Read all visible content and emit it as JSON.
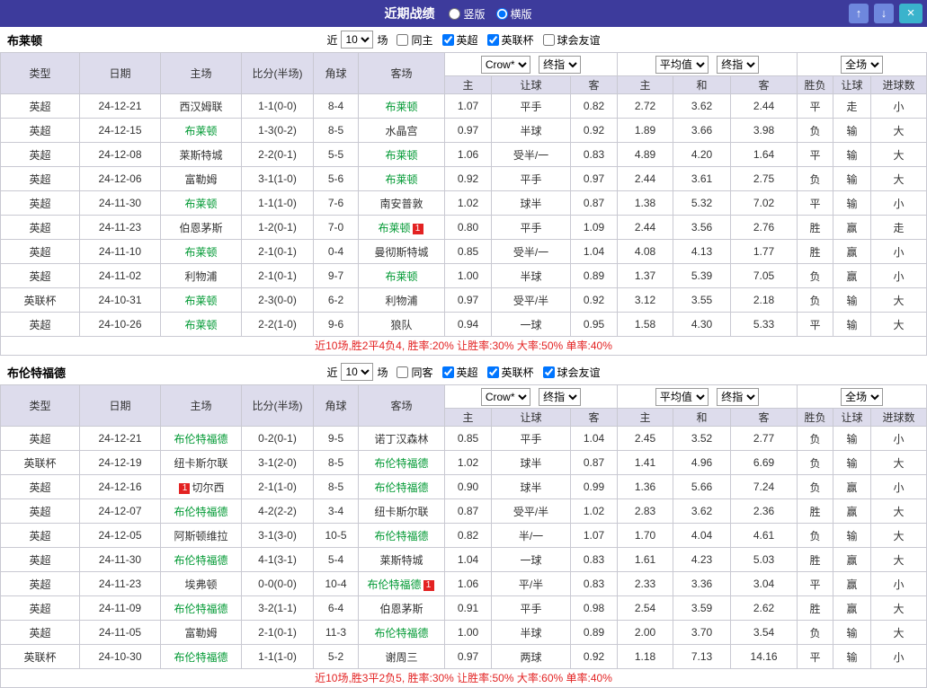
{
  "colors": {
    "titlebar_bg": "#3d3b9c",
    "btn_blue": "#6e87dd",
    "btn_teal": "#3ab3cc",
    "header_bg": "#dddcec",
    "league_bg": "#e83434",
    "league_cup_bg": "#d42f2f",
    "red": "#e32222",
    "green": "#009933",
    "blue": "#1f1fd0"
  },
  "titlebar": {
    "title": "近期战绩",
    "radios": [
      {
        "label": "竖版",
        "selected": false
      },
      {
        "label": "横版",
        "selected": true
      }
    ],
    "buttons": {
      "up": "↑",
      "down": "↓",
      "close": "×"
    }
  },
  "table_columns": {
    "main": [
      "类型",
      "日期",
      "主场",
      "比分(半场)",
      "角球",
      "客场"
    ],
    "sub": [
      "主",
      "让球",
      "客",
      "主",
      "和",
      "客",
      "胜负",
      "让球",
      "进球数"
    ]
  },
  "sections": [
    {
      "team": "布莱顿",
      "filter": {
        "near_label": "近",
        "count": "10",
        "unit_label": "场",
        "same": {
          "label": "同主",
          "checked": false
        },
        "leagues": [
          {
            "label": "英超",
            "checked": true
          },
          {
            "label": "英联杯",
            "checked": true
          },
          {
            "label": "球会友谊",
            "checked": false
          }
        ]
      },
      "dropdowns": {
        "odds_source": "Crow*",
        "odds_stage": "终指",
        "avg_type": "平均值",
        "avg_stage": "终指",
        "scope": "全场"
      },
      "rows": [
        {
          "type": "英超",
          "date": "24-12-21",
          "home": {
            "name": "西汉姆联"
          },
          "score": "1-1(0-0)",
          "corners": "8-4",
          "away": {
            "name": "布莱顿",
            "focus": true
          },
          "odds": [
            "1.07",
            "平手",
            "0.82"
          ],
          "avg": [
            "2.72",
            "3.62",
            "2.44"
          ],
          "result": "平",
          "hres": "走",
          "goals": "小"
        },
        {
          "type": "英超",
          "date": "24-12-15",
          "home": {
            "name": "布莱顿",
            "focus": true
          },
          "score": "1-3(0-2)",
          "corners": "8-5",
          "away": {
            "name": "水晶宫"
          },
          "odds": [
            "0.97",
            "半球",
            "0.92"
          ],
          "avg": [
            "1.89",
            "3.66",
            "3.98"
          ],
          "result": "负",
          "hres": "输",
          "goals": "大"
        },
        {
          "type": "英超",
          "date": "24-12-08",
          "home": {
            "name": "莱斯特城"
          },
          "score": "2-2(0-1)",
          "corners": "5-5",
          "away": {
            "name": "布莱顿",
            "focus": true
          },
          "odds": [
            "1.06",
            "受半/一",
            "0.83"
          ],
          "avg": [
            "4.89",
            "4.20",
            "1.64"
          ],
          "result": "平",
          "hres": "输",
          "goals": "大"
        },
        {
          "type": "英超",
          "date": "24-12-06",
          "home": {
            "name": "富勒姆"
          },
          "score": "3-1(1-0)",
          "corners": "5-6",
          "away": {
            "name": "布莱顿",
            "focus": true
          },
          "odds": [
            "0.92",
            "平手",
            "0.97"
          ],
          "avg": [
            "2.44",
            "3.61",
            "2.75"
          ],
          "result": "负",
          "hres": "输",
          "goals": "大"
        },
        {
          "type": "英超",
          "date": "24-11-30",
          "home": {
            "name": "布莱顿",
            "focus": true
          },
          "score": "1-1(1-0)",
          "corners": "7-6",
          "away": {
            "name": "南安普敦"
          },
          "odds": [
            "1.02",
            "球半",
            "0.87"
          ],
          "avg": [
            "1.38",
            "5.32",
            "7.02"
          ],
          "result": "平",
          "hres": "输",
          "goals": "小"
        },
        {
          "type": "英超",
          "date": "24-11-23",
          "home": {
            "name": "伯恩茅斯"
          },
          "score": "1-2(0-1)",
          "corners": "7-0",
          "away": {
            "name": "布莱顿",
            "focus": true,
            "card": "after"
          },
          "odds": [
            "0.80",
            "平手",
            "1.09"
          ],
          "avg": [
            "2.44",
            "3.56",
            "2.76"
          ],
          "result": "胜",
          "hres": "赢",
          "goals": "走"
        },
        {
          "type": "英超",
          "date": "24-11-10",
          "home": {
            "name": "布莱顿",
            "focus": true
          },
          "score": "2-1(0-1)",
          "corners": "0-4",
          "away": {
            "name": "曼彻斯特城"
          },
          "odds": [
            "0.85",
            "受半/一",
            "1.04"
          ],
          "avg": [
            "4.08",
            "4.13",
            "1.77"
          ],
          "result": "胜",
          "hres": "赢",
          "goals": "小"
        },
        {
          "type": "英超",
          "date": "24-11-02",
          "home": {
            "name": "利物浦"
          },
          "score": "2-1(0-1)",
          "corners": "9-7",
          "away": {
            "name": "布莱顿",
            "focus": true
          },
          "odds": [
            "1.00",
            "半球",
            "0.89"
          ],
          "avg": [
            "1.37",
            "5.39",
            "7.05"
          ],
          "result": "负",
          "hres": "赢",
          "goals": "小"
        },
        {
          "type": "英联杯",
          "date": "24-10-31",
          "home": {
            "name": "布莱顿",
            "focus": true
          },
          "score": "2-3(0-0)",
          "corners": "6-2",
          "away": {
            "name": "利物浦"
          },
          "odds": [
            "0.97",
            "受平/半",
            "0.92"
          ],
          "avg": [
            "3.12",
            "3.55",
            "2.18"
          ],
          "result": "负",
          "hres": "输",
          "goals": "大"
        },
        {
          "type": "英超",
          "date": "24-10-26",
          "home": {
            "name": "布莱顿",
            "focus": true
          },
          "score": "2-2(1-0)",
          "corners": "9-6",
          "away": {
            "name": "狼队"
          },
          "odds": [
            "0.94",
            "一球",
            "0.95"
          ],
          "avg": [
            "1.58",
            "4.30",
            "5.33"
          ],
          "result": "平",
          "hres": "输",
          "goals": "大"
        }
      ],
      "summary": "近10场,胜2平4负4, 胜率:20% 让胜率:30% 大率:50% 单率:40%"
    },
    {
      "team": "布伦特福德",
      "filter": {
        "near_label": "近",
        "count": "10",
        "unit_label": "场",
        "same": {
          "label": "同客",
          "checked": false
        },
        "leagues": [
          {
            "label": "英超",
            "checked": true
          },
          {
            "label": "英联杯",
            "checked": true
          },
          {
            "label": "球会友谊",
            "checked": true
          }
        ]
      },
      "dropdowns": {
        "odds_source": "Crow*",
        "odds_stage": "终指",
        "avg_type": "平均值",
        "avg_stage": "终指",
        "scope": "全场"
      },
      "rows": [
        {
          "type": "英超",
          "date": "24-12-21",
          "home": {
            "name": "布伦特福德",
            "focus": true
          },
          "score": "0-2(0-1)",
          "corners": "9-5",
          "away": {
            "name": "诺丁汉森林"
          },
          "odds": [
            "0.85",
            "平手",
            "1.04"
          ],
          "avg": [
            "2.45",
            "3.52",
            "2.77"
          ],
          "result": "负",
          "hres": "输",
          "goals": "小"
        },
        {
          "type": "英联杯",
          "date": "24-12-19",
          "home": {
            "name": "纽卡斯尔联"
          },
          "score": "3-1(2-0)",
          "corners": "8-5",
          "away": {
            "name": "布伦特福德",
            "focus": true
          },
          "odds": [
            "1.02",
            "球半",
            "0.87"
          ],
          "avg": [
            "1.41",
            "4.96",
            "6.69"
          ],
          "result": "负",
          "hres": "输",
          "goals": "大"
        },
        {
          "type": "英超",
          "date": "24-12-16",
          "home": {
            "name": "切尔西",
            "card": "before"
          },
          "score": "2-1(1-0)",
          "corners": "8-5",
          "away": {
            "name": "布伦特福德",
            "focus": true
          },
          "odds": [
            "0.90",
            "球半",
            "0.99"
          ],
          "avg": [
            "1.36",
            "5.66",
            "7.24"
          ],
          "result": "负",
          "hres": "赢",
          "goals": "小"
        },
        {
          "type": "英超",
          "date": "24-12-07",
          "home": {
            "name": "布伦特福德",
            "focus": true
          },
          "score": "4-2(2-2)",
          "corners": "3-4",
          "away": {
            "name": "纽卡斯尔联"
          },
          "odds": [
            "0.87",
            "受平/半",
            "1.02"
          ],
          "avg": [
            "2.83",
            "3.62",
            "2.36"
          ],
          "result": "胜",
          "hres": "赢",
          "goals": "大"
        },
        {
          "type": "英超",
          "date": "24-12-05",
          "home": {
            "name": "阿斯顿维拉"
          },
          "score": "3-1(3-0)",
          "corners": "10-5",
          "away": {
            "name": "布伦特福德",
            "focus": true
          },
          "odds": [
            "0.82",
            "半/一",
            "1.07"
          ],
          "avg": [
            "1.70",
            "4.04",
            "4.61"
          ],
          "result": "负",
          "hres": "输",
          "goals": "大"
        },
        {
          "type": "英超",
          "date": "24-11-30",
          "home": {
            "name": "布伦特福德",
            "focus": true
          },
          "score": "4-1(3-1)",
          "corners": "5-4",
          "away": {
            "name": "莱斯特城"
          },
          "odds": [
            "1.04",
            "一球",
            "0.83"
          ],
          "avg": [
            "1.61",
            "4.23",
            "5.03"
          ],
          "result": "胜",
          "hres": "赢",
          "goals": "大"
        },
        {
          "type": "英超",
          "date": "24-11-23",
          "home": {
            "name": "埃弗顿"
          },
          "score": "0-0(0-0)",
          "corners": "10-4",
          "away": {
            "name": "布伦特福德",
            "focus": true,
            "card": "after"
          },
          "odds": [
            "1.06",
            "平/半",
            "0.83"
          ],
          "avg": [
            "2.33",
            "3.36",
            "3.04"
          ],
          "result": "平",
          "hres": "赢",
          "goals": "小"
        },
        {
          "type": "英超",
          "date": "24-11-09",
          "home": {
            "name": "布伦特福德",
            "focus": true
          },
          "score": "3-2(1-1)",
          "corners": "6-4",
          "away": {
            "name": "伯恩茅斯"
          },
          "odds": [
            "0.91",
            "平手",
            "0.98"
          ],
          "avg": [
            "2.54",
            "3.59",
            "2.62"
          ],
          "result": "胜",
          "hres": "赢",
          "goals": "大"
        },
        {
          "type": "英超",
          "date": "24-11-05",
          "home": {
            "name": "富勒姆"
          },
          "score": "2-1(0-1)",
          "corners": "11-3",
          "away": {
            "name": "布伦特福德",
            "focus": true
          },
          "odds": [
            "1.00",
            "半球",
            "0.89"
          ],
          "avg": [
            "2.00",
            "3.70",
            "3.54"
          ],
          "result": "负",
          "hres": "输",
          "goals": "大"
        },
        {
          "type": "英联杯",
          "date": "24-10-30",
          "home": {
            "name": "布伦特福德",
            "focus": true
          },
          "score": "1-1(1-0)",
          "corners": "5-2",
          "away": {
            "name": "谢周三"
          },
          "odds": [
            "0.97",
            "两球",
            "0.92"
          ],
          "avg": [
            "1.18",
            "7.13",
            "14.16"
          ],
          "result": "平",
          "hres": "输",
          "goals": "小"
        }
      ],
      "summary": "近10场,胜3平2负5, 胜率:30% 让胜率:50% 大率:60% 单率:40%"
    }
  ]
}
